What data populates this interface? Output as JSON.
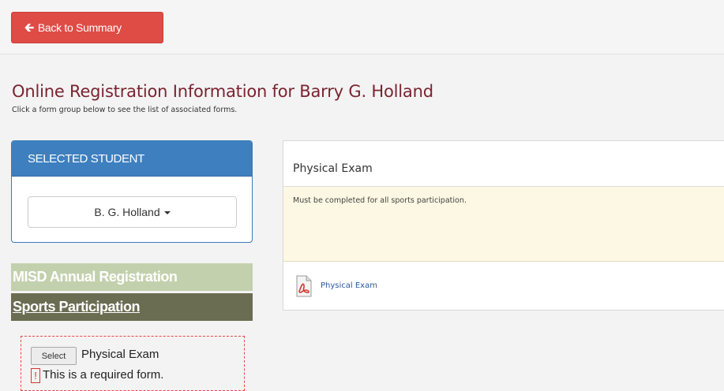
{
  "header": {
    "back_label": "Back to Summary"
  },
  "page": {
    "title": "Online Registration Information for Barry G. Holland",
    "subtitle": "Click a form group below to see the list of associated forms."
  },
  "student_panel": {
    "heading": "SELECTED STUDENT",
    "selected_student": "B. G. Holland"
  },
  "form_groups": [
    {
      "label": "MISD Annual Registration"
    },
    {
      "label": "Sports Participation"
    }
  ],
  "forms": [
    {
      "select_label": "Select",
      "name": "Physical Exam",
      "required_mark": "!",
      "required_text": "This is a required form."
    }
  ],
  "detail": {
    "title": "Physical Exam",
    "note": "Must be completed for all sports participation.",
    "link_label": "Physical Exam",
    "link_icon": "pdf-file-icon"
  },
  "colors": {
    "danger_button": "#df4b45",
    "panel_header": "#3e7fbf",
    "title_text": "#7a2430",
    "group_annual": "#c3d0ad",
    "group_sports": "#6a6d52",
    "warning_bg": "#fcf8e3"
  }
}
